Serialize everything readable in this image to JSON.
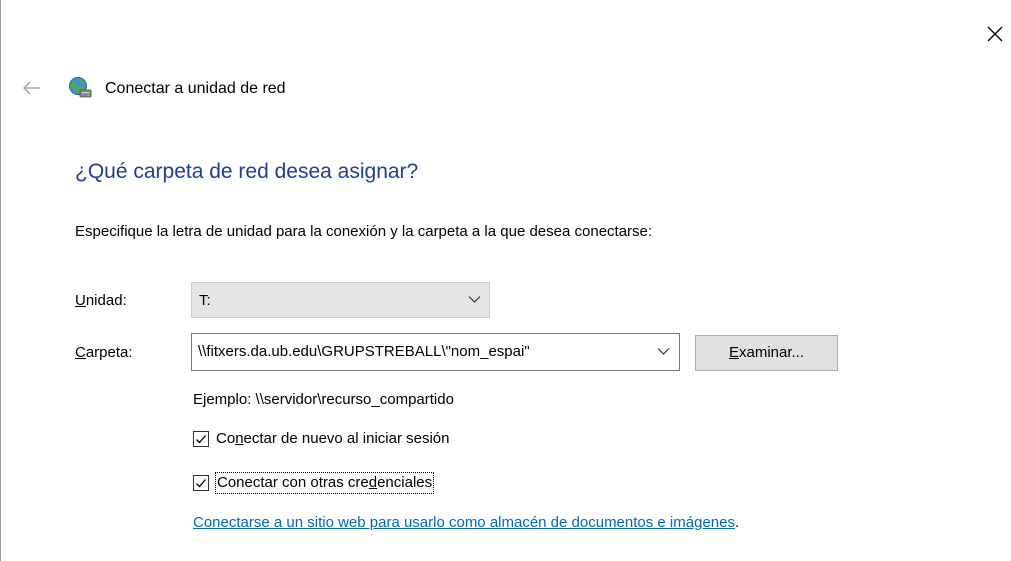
{
  "window": {
    "title": "Conectar a unidad de red",
    "close_icon": "close-icon",
    "back_icon": "back-arrow-icon",
    "header_icon": "network-drive-icon"
  },
  "main": {
    "question": "¿Qué carpeta de red desea asignar?",
    "instruction": "Especifique la letra de unidad para la conexión y la carpeta a la que desea conectarse:",
    "drive": {
      "label_mnemonic": "U",
      "label_rest": "nidad:",
      "value": "T:"
    },
    "folder": {
      "label_mnemonic": "C",
      "label_rest": "arpeta:",
      "value": "\\\\fitxers.da.ub.edu\\GRUPSTREBALL\\\"nom_espai\"",
      "browse_mnemonic": "E",
      "browse_rest": "xaminar..."
    },
    "example": "Ejemplo: \\\\servidor\\recurso_compartido",
    "checkboxes": [
      {
        "label_before": "Co",
        "label_mnemonic": "n",
        "label_after": "ectar de nuevo al iniciar sesión",
        "checked": true
      },
      {
        "label_before": "Conectar con otras cre",
        "label_mnemonic": "d",
        "label_after": "enciales",
        "checked": true
      }
    ],
    "link": "Conectarse a un sitio web para usarlo como almacén de documentos e imágenes",
    "link_suffix": "."
  },
  "colors": {
    "heading": "#1e3f96",
    "link": "#0066cc",
    "combo_bg": "#e5e5e5",
    "button_bg": "#e1e1e1"
  }
}
